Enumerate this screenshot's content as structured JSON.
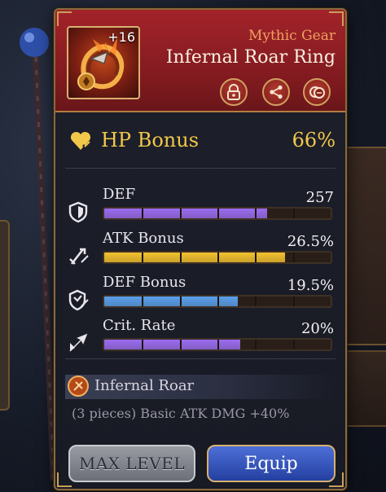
{
  "item": {
    "level": "+16",
    "rarity": "Mythic Gear",
    "name": "Infernal Roar Ring",
    "header_actions": [
      {
        "icon": "lock-icon"
      },
      {
        "icon": "share-icon"
      },
      {
        "icon": "coins-icon"
      }
    ]
  },
  "main_stat": {
    "label": "HP Bonus",
    "value": "66%",
    "icon": "heart-bonus-icon"
  },
  "sub_stats": [
    {
      "label": "DEF",
      "value": "257",
      "icon": "shield-icon",
      "fill": 0.72,
      "color": "#9a6cf0"
    },
    {
      "label": "ATK Bonus",
      "value": "26.5%",
      "icon": "sword-bonus-icon",
      "fill": 0.8,
      "color": "#f2c230"
    },
    {
      "label": "DEF Bonus",
      "value": "19.5%",
      "icon": "shield-bonus-icon",
      "fill": 0.59,
      "color": "#5aa0ec"
    },
    {
      "label": "Crit. Rate",
      "value": "20%",
      "icon": "crit-arrow-icon",
      "fill": 0.6,
      "color": "#9a6cf0"
    }
  ],
  "set_bonus": {
    "name": "Infernal Roar",
    "description": "(3 pieces) Basic ATK DMG +40%",
    "icon": "infernal-roar-set-icon"
  },
  "buttons": {
    "max_level": "MAX LEVEL",
    "equip": "Equip"
  },
  "colors": {
    "header_red": "#a3232a",
    "gold": "#f1c84a",
    "rarity_orange": "#f0a060",
    "equip_blue": "#3558c0"
  }
}
